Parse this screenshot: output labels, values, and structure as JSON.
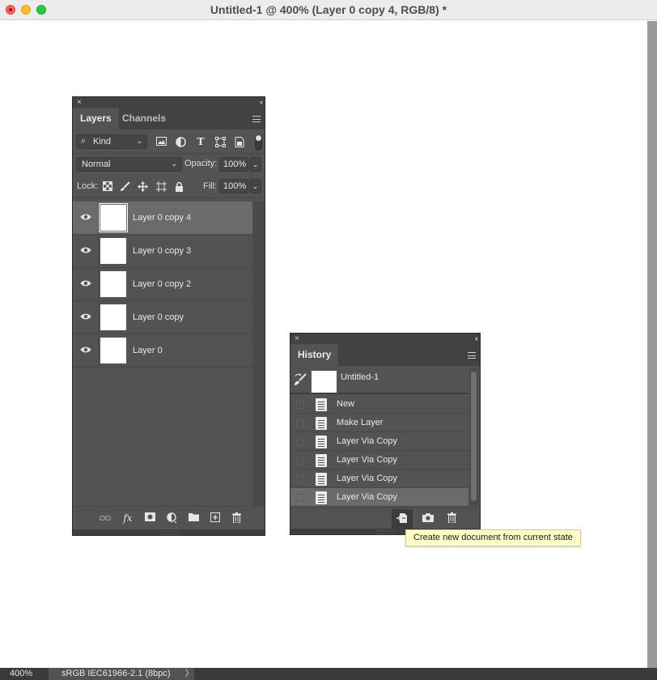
{
  "window": {
    "title": "Untitled-1 @ 400% (Layer 0 copy 4, RGB/8) *"
  },
  "status_bar": {
    "zoom": "400%",
    "profile": "sRGB IEC61966-2.1 (8bpc)",
    "arrow": "〉"
  },
  "layers_panel": {
    "close_glyph": "×",
    "collapse_glyph": "‹‹",
    "tabs": [
      {
        "label": "Layers",
        "active": true
      },
      {
        "label": "Channels",
        "active": false
      }
    ],
    "filter": {
      "kind_label": "Kind",
      "filter_icons": [
        "image-filter-icon",
        "adjustment-filter-icon",
        "type-filter-icon",
        "shape-filter-icon",
        "smart-object-filter-icon"
      ],
      "type_glyph": "T"
    },
    "blend_mode": "Normal",
    "opacity_label": "Opacity:",
    "opacity_value": "100%",
    "lock_label": "Lock:",
    "lock_icons": [
      "lock-transparent-pixels-icon",
      "lock-image-pixels-icon",
      "lock-position-icon",
      "lock-artboard-icon",
      "lock-all-icon"
    ],
    "fill_label": "Fill:",
    "fill_value": "100%",
    "layers": [
      {
        "name": "Layer 0 copy 4",
        "selected": true,
        "visible": true
      },
      {
        "name": "Layer 0 copy 3",
        "selected": false,
        "visible": true
      },
      {
        "name": "Layer 0 copy 2",
        "selected": false,
        "visible": true
      },
      {
        "name": "Layer 0 copy",
        "selected": false,
        "visible": true
      },
      {
        "name": "Layer 0",
        "selected": false,
        "visible": true
      }
    ],
    "bottom_icons": [
      "link-layers-icon",
      "fx-icon",
      "add-mask-icon",
      "adjustment-layer-icon",
      "new-group-icon",
      "new-layer-icon",
      "delete-layer-icon"
    ],
    "fx_label": "fx"
  },
  "history_panel": {
    "close_glyph": "×",
    "collapse_glyph": "‹‹",
    "tab_label": "History",
    "snapshot_name": "Untitled-1",
    "states": [
      {
        "name": "New",
        "current": false
      },
      {
        "name": "Make Layer",
        "current": false
      },
      {
        "name": "Layer Via Copy",
        "current": false
      },
      {
        "name": "Layer Via Copy",
        "current": false
      },
      {
        "name": "Layer Via Copy",
        "current": false
      },
      {
        "name": "Layer Via Copy",
        "current": true
      }
    ],
    "bottom_icons": [
      "new-document-from-state-icon",
      "camera-snapshot-icon",
      "delete-state-icon"
    ]
  },
  "tooltip": {
    "text": "Create new document from current state"
  },
  "colors": {
    "panel_bg": "#535353",
    "panel_header": "#424242",
    "selected_row": "#6b6b6b",
    "tooltip_bg": "#fefdc8"
  }
}
